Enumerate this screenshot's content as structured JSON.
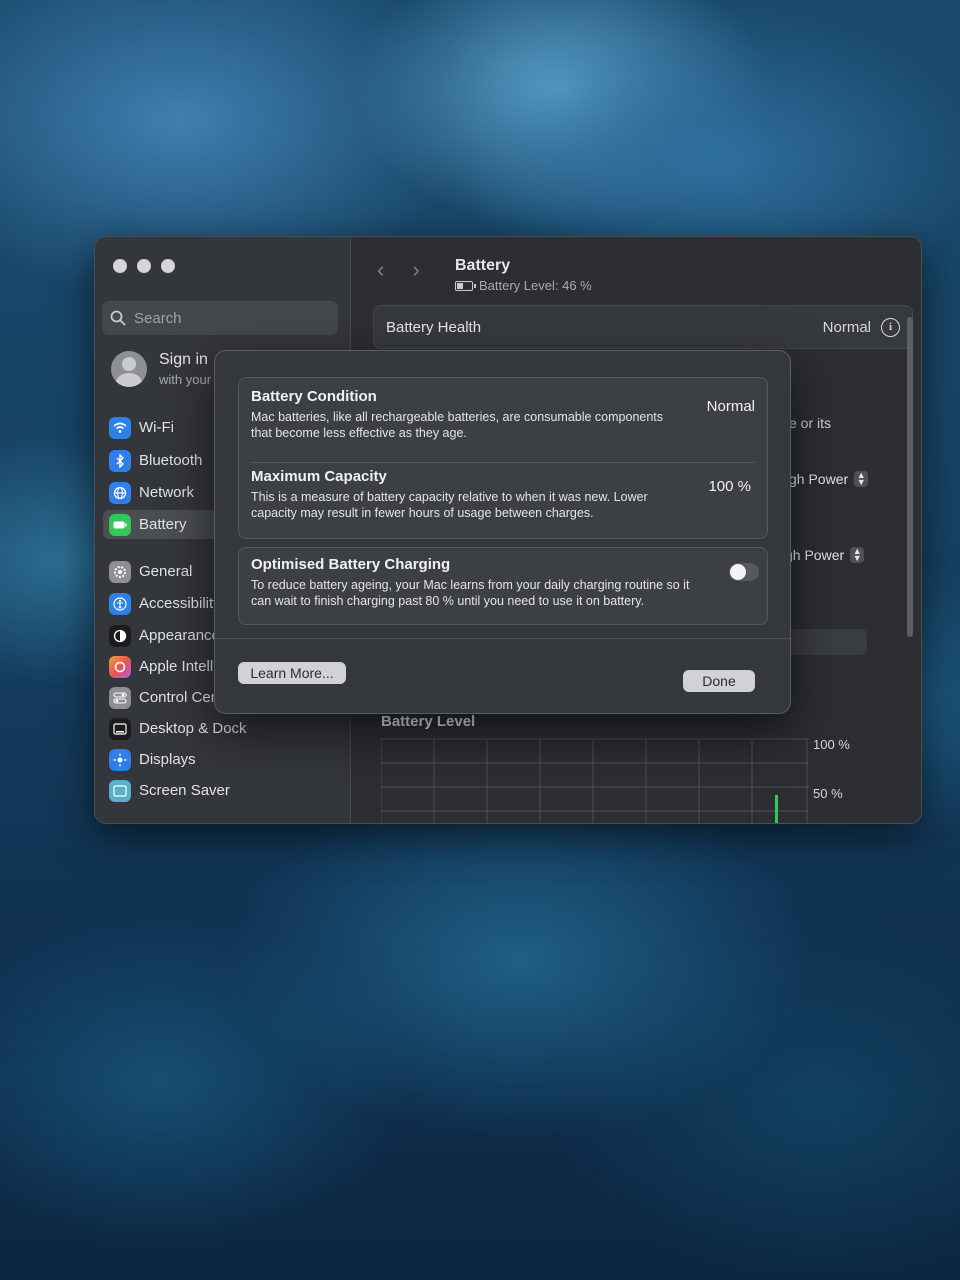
{
  "window": {
    "title": "Battery",
    "subtitle": "Battery Level: 46 %"
  },
  "sidebar": {
    "search_placeholder": "Search",
    "signin": {
      "title": "Sign in",
      "subtitle": "with your"
    },
    "items": [
      {
        "label": "Wi-Fi",
        "icon": "wifi-icon",
        "color": "#2f7fe8"
      },
      {
        "label": "Bluetooth",
        "icon": "bluetooth-icon",
        "color": "#2f7fe8"
      },
      {
        "label": "Network",
        "icon": "globe-icon",
        "color": "#2f7fe8"
      },
      {
        "label": "Battery",
        "icon": "battery-icon",
        "color": "#34c759"
      },
      {
        "label": "General",
        "icon": "gear-icon",
        "color": "#8e8e93"
      },
      {
        "label": "Accessibility",
        "icon": "accessibility-icon",
        "color": "#2f7fe8"
      },
      {
        "label": "Appearance",
        "icon": "appearance-icon",
        "color": "#1c1c1e"
      },
      {
        "label": "Apple Intelligence",
        "icon": "apple-intelligence-icon",
        "color": "#e8574f"
      },
      {
        "label": "Control Centre",
        "icon": "control-centre-icon",
        "color": "#8e8e93"
      },
      {
        "label": "Desktop & Dock",
        "icon": "dock-icon",
        "color": "#1c1c1e"
      },
      {
        "label": "Displays",
        "icon": "displays-icon",
        "color": "#2f7fe8"
      },
      {
        "label": "Screen Saver",
        "icon": "screen-saver-icon",
        "color": "#5ab0c8"
      }
    ]
  },
  "main": {
    "health_label": "Battery Health",
    "health_value": "Normal",
    "partial_text": "e or its",
    "power_mode_1": "gh Power",
    "power_mode_2": "gh Power",
    "partial_s": "s",
    "chart_title": "Battery Level",
    "chart_axis_top": "100 %",
    "chart_axis_mid": "50 %"
  },
  "sheet": {
    "condition_title": "Battery Condition",
    "condition_desc": "Mac batteries, like all rechargeable batteries, are consumable components that become less effective as they age.",
    "condition_value": "Normal",
    "capacity_title": "Maximum Capacity",
    "capacity_desc": "This is a measure of battery capacity relative to when it was new. Lower capacity may result in fewer hours of usage between charges.",
    "capacity_value": "100 %",
    "optimised_title": "Optimised Battery Charging",
    "optimised_desc": "To reduce battery ageing, your Mac learns from your daily charging routine so it can wait to finish charging past 80 % until you need to use it on battery.",
    "optimised_enabled": false,
    "learn_more_label": "Learn More...",
    "done_label": "Done"
  }
}
